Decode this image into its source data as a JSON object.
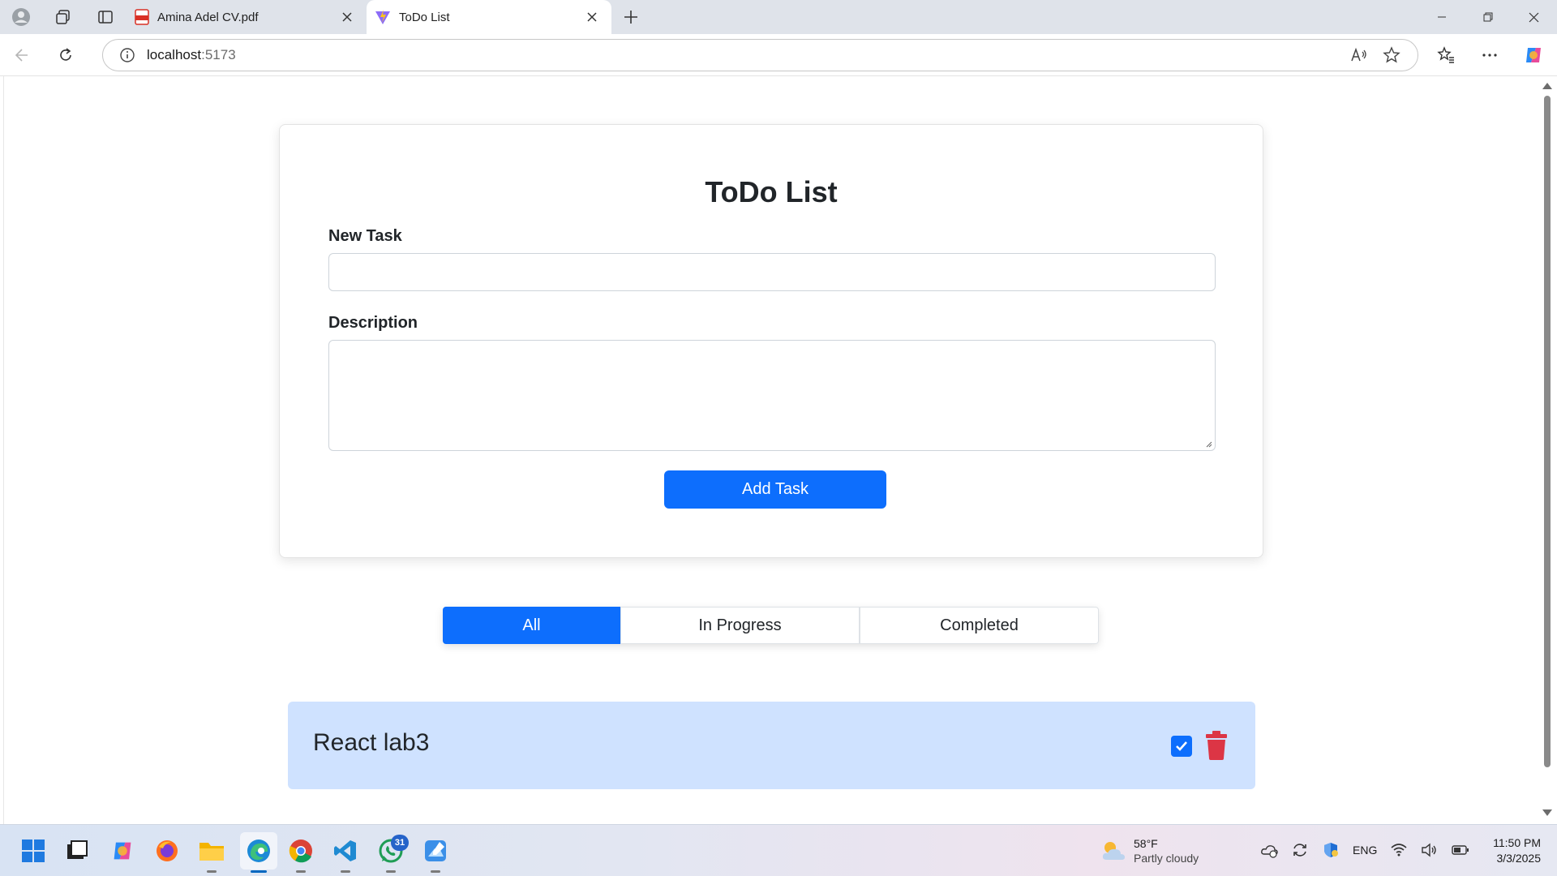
{
  "browser": {
    "tabs": [
      {
        "title": "Amina Adel CV.pdf",
        "active": false,
        "icon": "pdf-icon"
      },
      {
        "title": "ToDo List",
        "active": true,
        "icon": "vite-icon"
      }
    ],
    "url_host": "localhost",
    "url_port": ":5173"
  },
  "page": {
    "heading": "ToDo List",
    "new_task_label": "New Task",
    "new_task_value": "",
    "description_label": "Description",
    "description_value": "",
    "add_button": "Add Task",
    "filters": [
      {
        "label": "All",
        "active": true
      },
      {
        "label": "In Progress",
        "active": false
      },
      {
        "label": "Completed",
        "active": false
      }
    ],
    "tasks": [
      {
        "title": "React lab3",
        "completed": true
      }
    ],
    "colors": {
      "primary": "#0d6efd",
      "task_bg": "#cfe2ff",
      "danger": "#dc3545"
    }
  },
  "taskbar": {
    "weather_temp": "58°F",
    "weather_condition": "Partly cloudy",
    "language": "ENG",
    "time": "11:50 PM",
    "date": "3/3/2025",
    "whatsapp_badge": "31",
    "apps": [
      "windows-start-icon",
      "task-view-icon",
      "copilot-icon",
      "firefox-icon",
      "file-explorer-icon",
      "edge-icon",
      "chrome-icon",
      "vscode-icon",
      "whatsapp-icon",
      "paint-icon"
    ]
  }
}
